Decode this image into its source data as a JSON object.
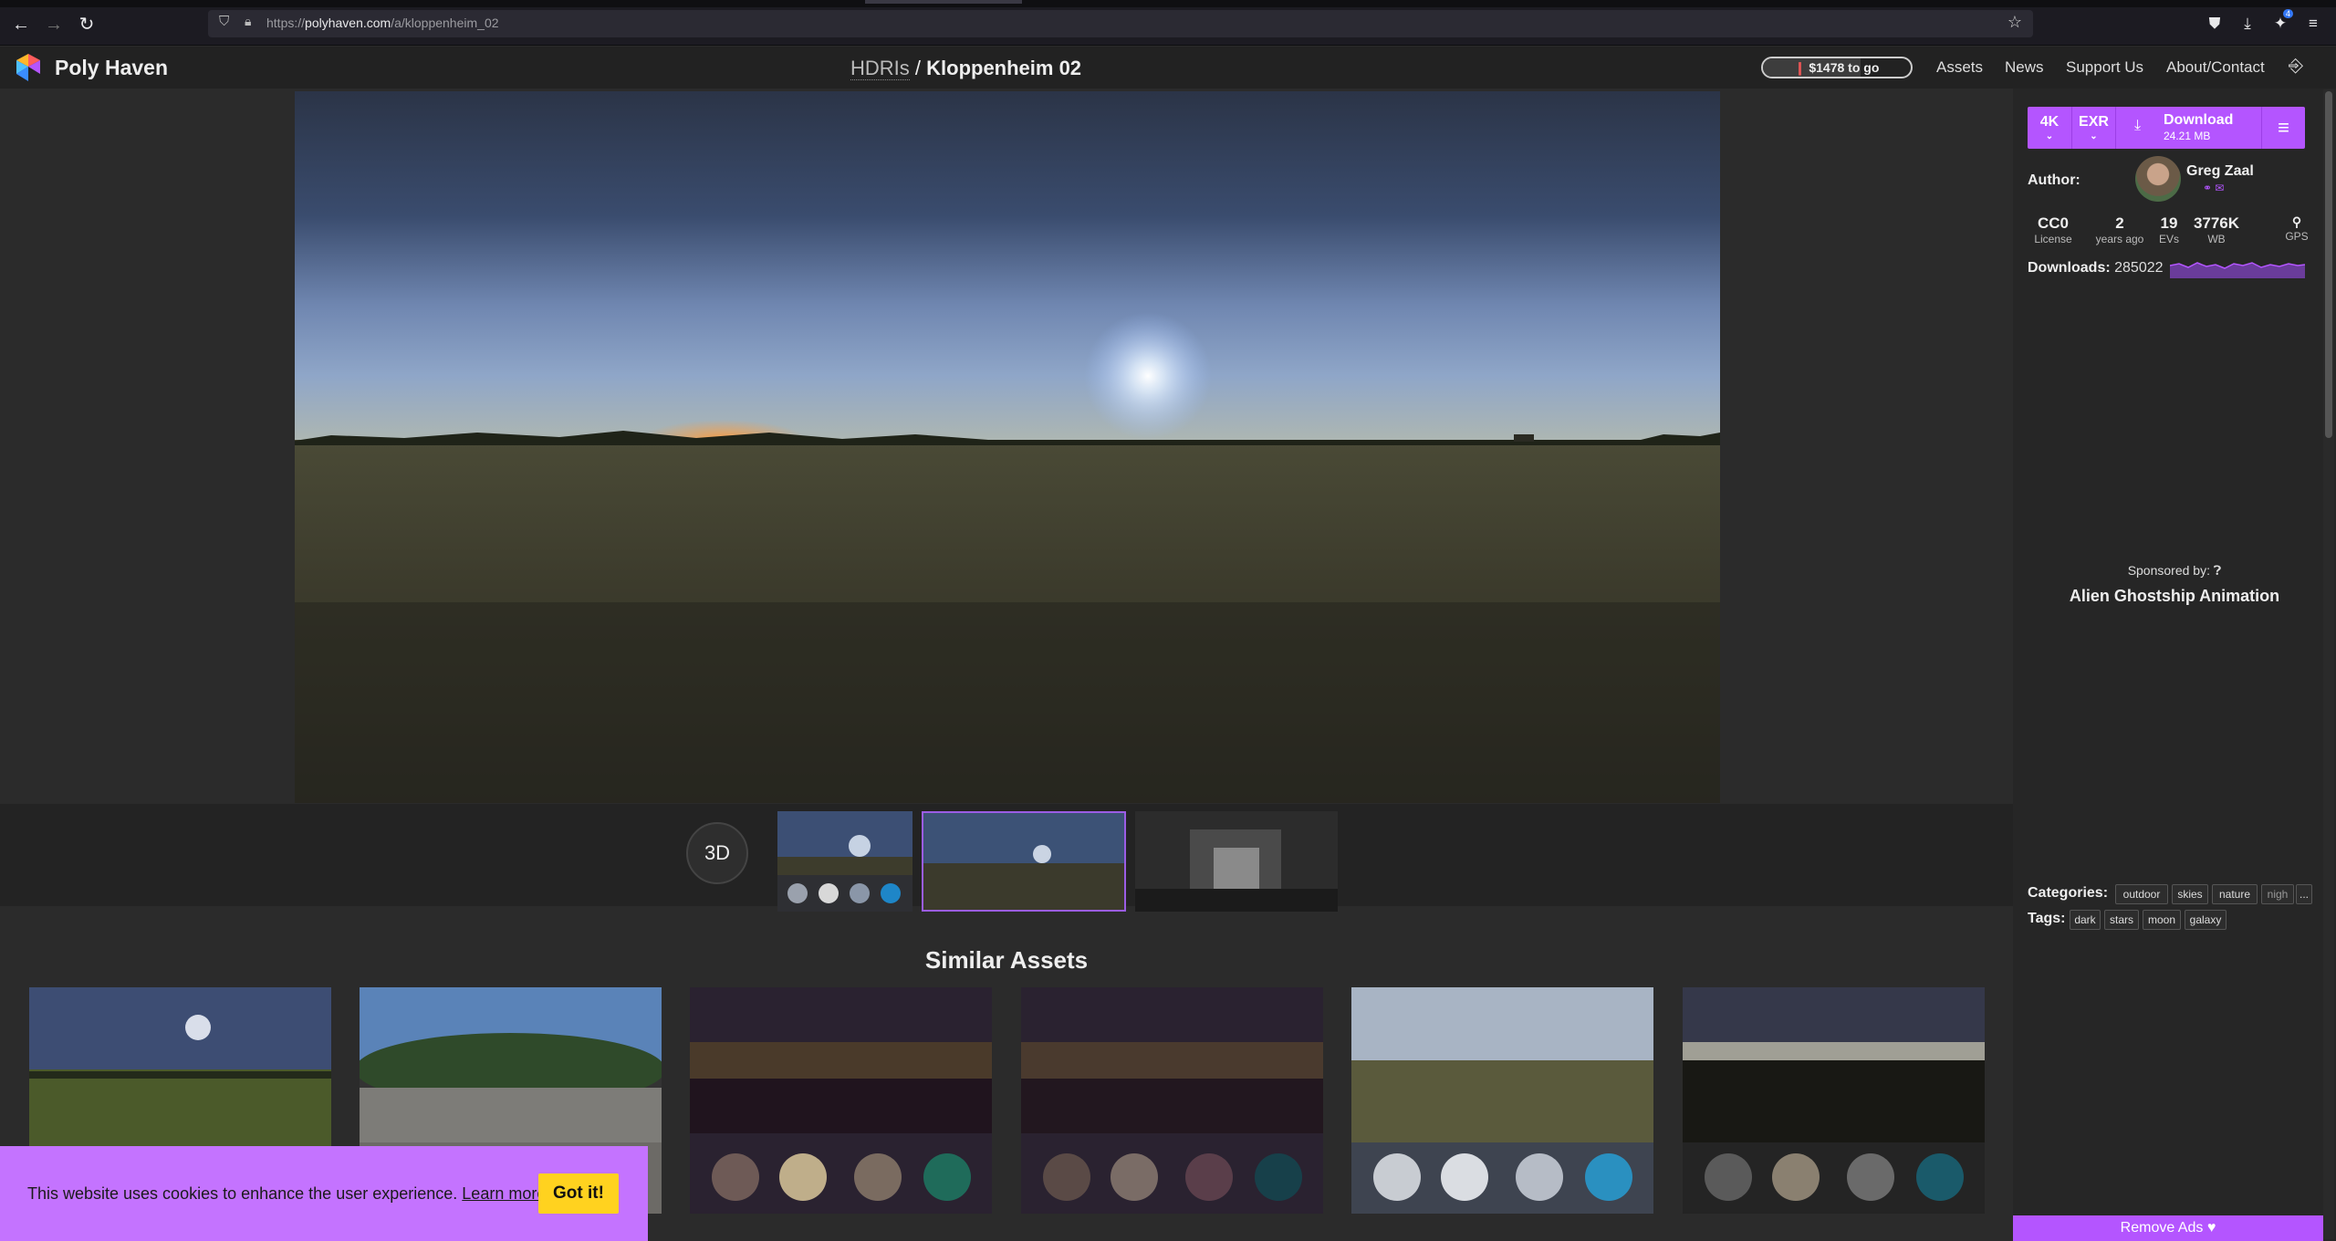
{
  "browser": {
    "url_prefix": "https://",
    "url_host": "polyhaven.com",
    "url_path": "/a/kloppenheim_02",
    "badge": "4"
  },
  "header": {
    "brand": "Poly Haven",
    "crumb_parent": "HDRIs",
    "crumb_sep": " / ",
    "crumb_title": "Kloppenheim 02",
    "goal_text": "$1478 to go",
    "nav": [
      "Assets",
      "News",
      "Support Us",
      "About/Contact"
    ]
  },
  "thumbs": {
    "btn3d": "3D"
  },
  "similar": {
    "title": "Similar Assets"
  },
  "sidebar": {
    "download": {
      "resolution": "4K",
      "format": "EXR",
      "label": "Download",
      "size": "24.21 MB"
    },
    "author_label": "Author:",
    "author_name": "Greg Zaal",
    "stats": [
      {
        "value": "CC0",
        "key": "License"
      },
      {
        "value": "2",
        "key": "years ago"
      },
      {
        "value": "19",
        "key": "EVs"
      },
      {
        "value": "3776K",
        "key": "WB"
      },
      {
        "value": "",
        "key": "GPS"
      }
    ],
    "downloads_label": "Downloads:",
    "downloads_value": "285022",
    "sponsor_label": "Sponsored by:",
    "sponsor_name": "Alien Ghostship Animation",
    "categories_label": "Categories:",
    "categories": [
      "outdoor",
      "skies",
      "nature",
      "nigh",
      "..."
    ],
    "tags_label": "Tags:",
    "tags": [
      "dark",
      "stars",
      "moon",
      "galaxy"
    ],
    "remove_ads": "Remove Ads"
  },
  "cookie": {
    "text": "This website uses cookies to enhance the user experience.",
    "link": "Learn more.",
    "button": "Got it!"
  },
  "colors": {
    "accent": "#b455ff",
    "cookie_bg": "#c473ff",
    "cookie_btn": "#ffd21f"
  }
}
